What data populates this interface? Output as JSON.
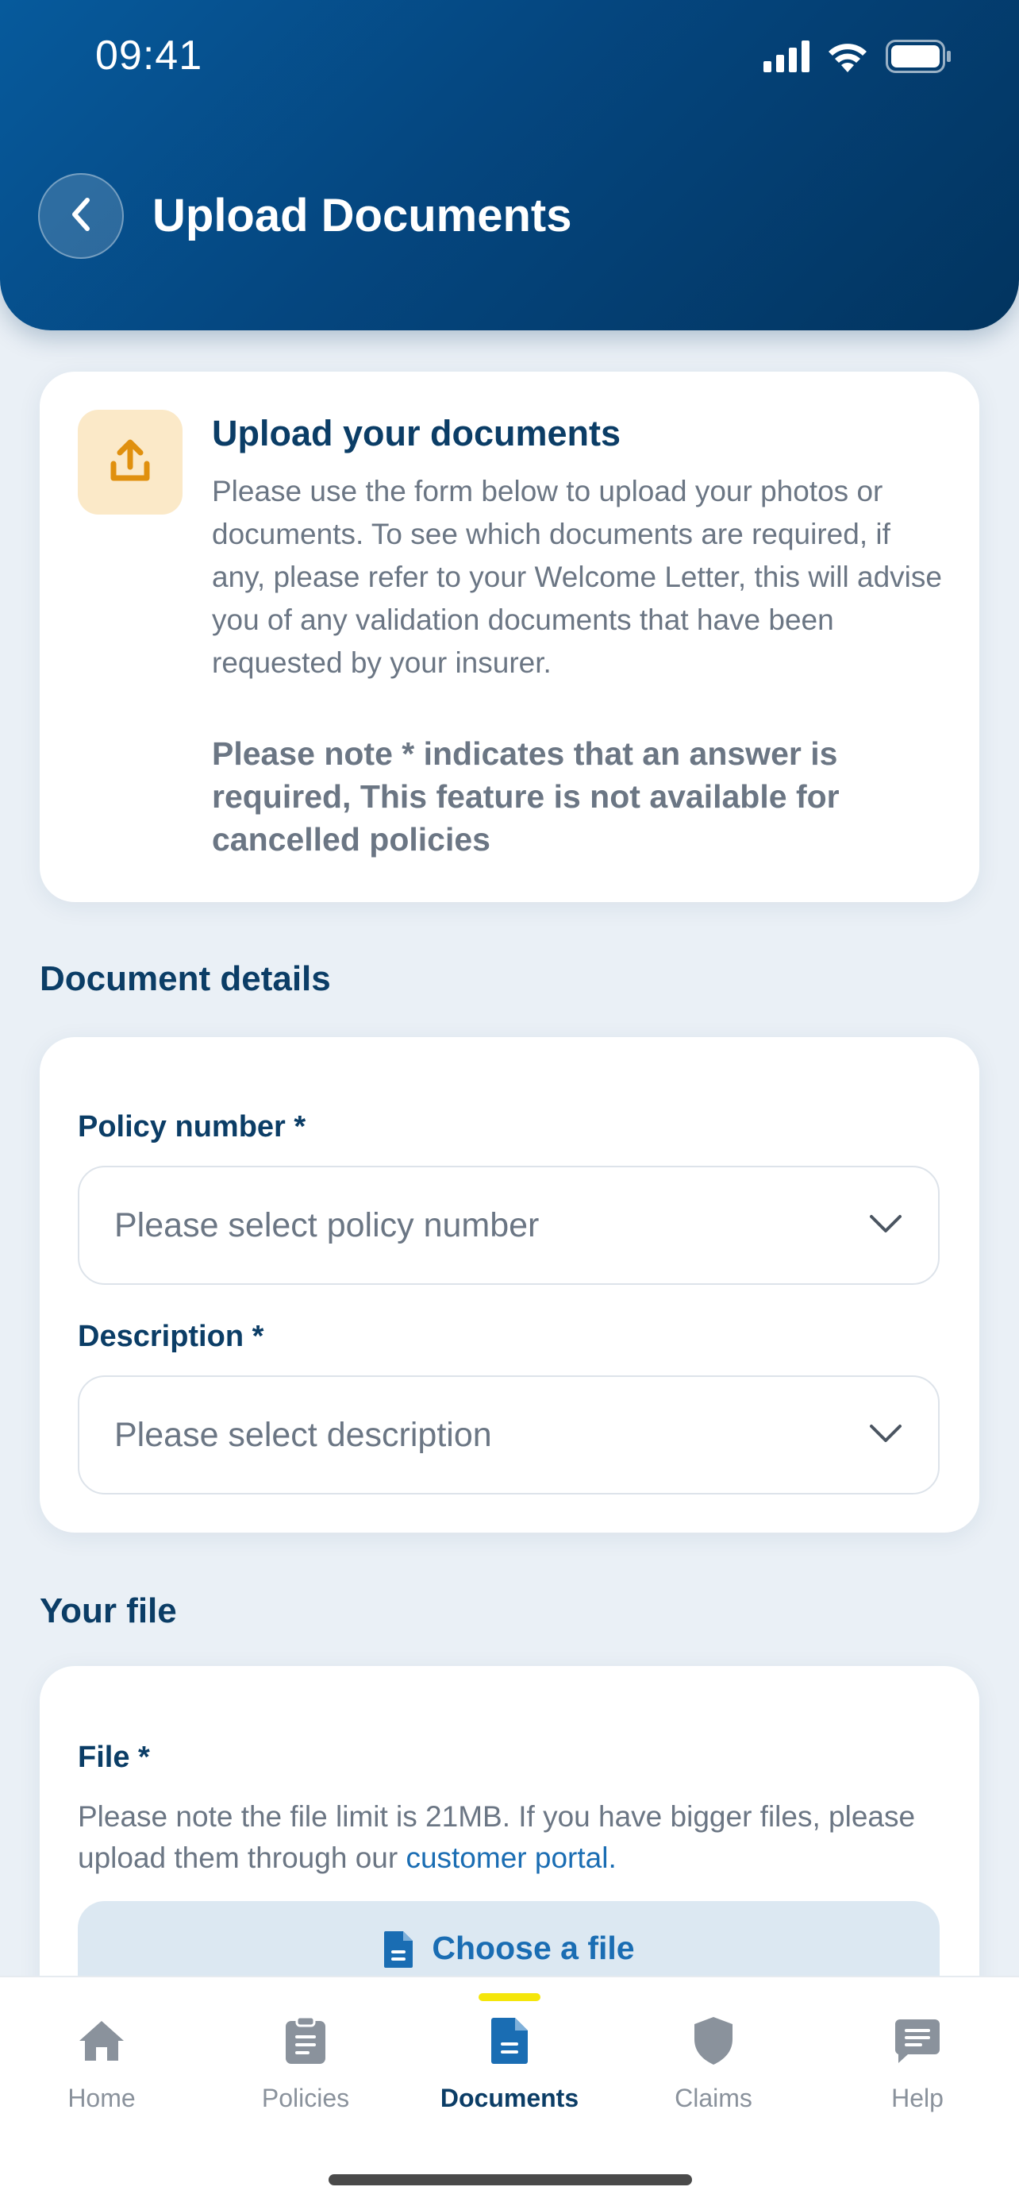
{
  "status_bar": {
    "time": "09:41"
  },
  "header": {
    "title": "Upload Documents"
  },
  "intro": {
    "title": "Upload your documents",
    "body": "Please use the form below to upload your photos or documents. To see which documents are required, if any, please refer to your Welcome Letter, this will advise you of any validation documents that have been requested by your insurer.",
    "note": "Please note * indicates that an answer is required, This feature is not available for cancelled policies"
  },
  "document_details": {
    "section_title": "Document details",
    "policy_label": "Policy number *",
    "policy_placeholder": "Please select policy number",
    "description_label": "Description *",
    "description_placeholder": "Please select description"
  },
  "your_file": {
    "section_title": "Your file",
    "file_label": "File *",
    "note_text": "Please note the file limit is 21MB. If you have bigger files, please upload them through our",
    "link_text": "customer portal.",
    "choose_label": "Choose a file"
  },
  "bottom_nav": {
    "items": [
      {
        "label": "Home",
        "icon": "home-icon"
      },
      {
        "label": "Policies",
        "icon": "clipboard-icon"
      },
      {
        "label": "Documents",
        "icon": "document-icon",
        "active": true
      },
      {
        "label": "Claims",
        "icon": "shield-icon"
      },
      {
        "label": "Help",
        "icon": "chat-icon"
      }
    ]
  },
  "colors": {
    "brand": "#05467f",
    "accent": "#1a6db3",
    "upload_icon": "#e0900e",
    "active_indicator": "#f5e60a"
  }
}
